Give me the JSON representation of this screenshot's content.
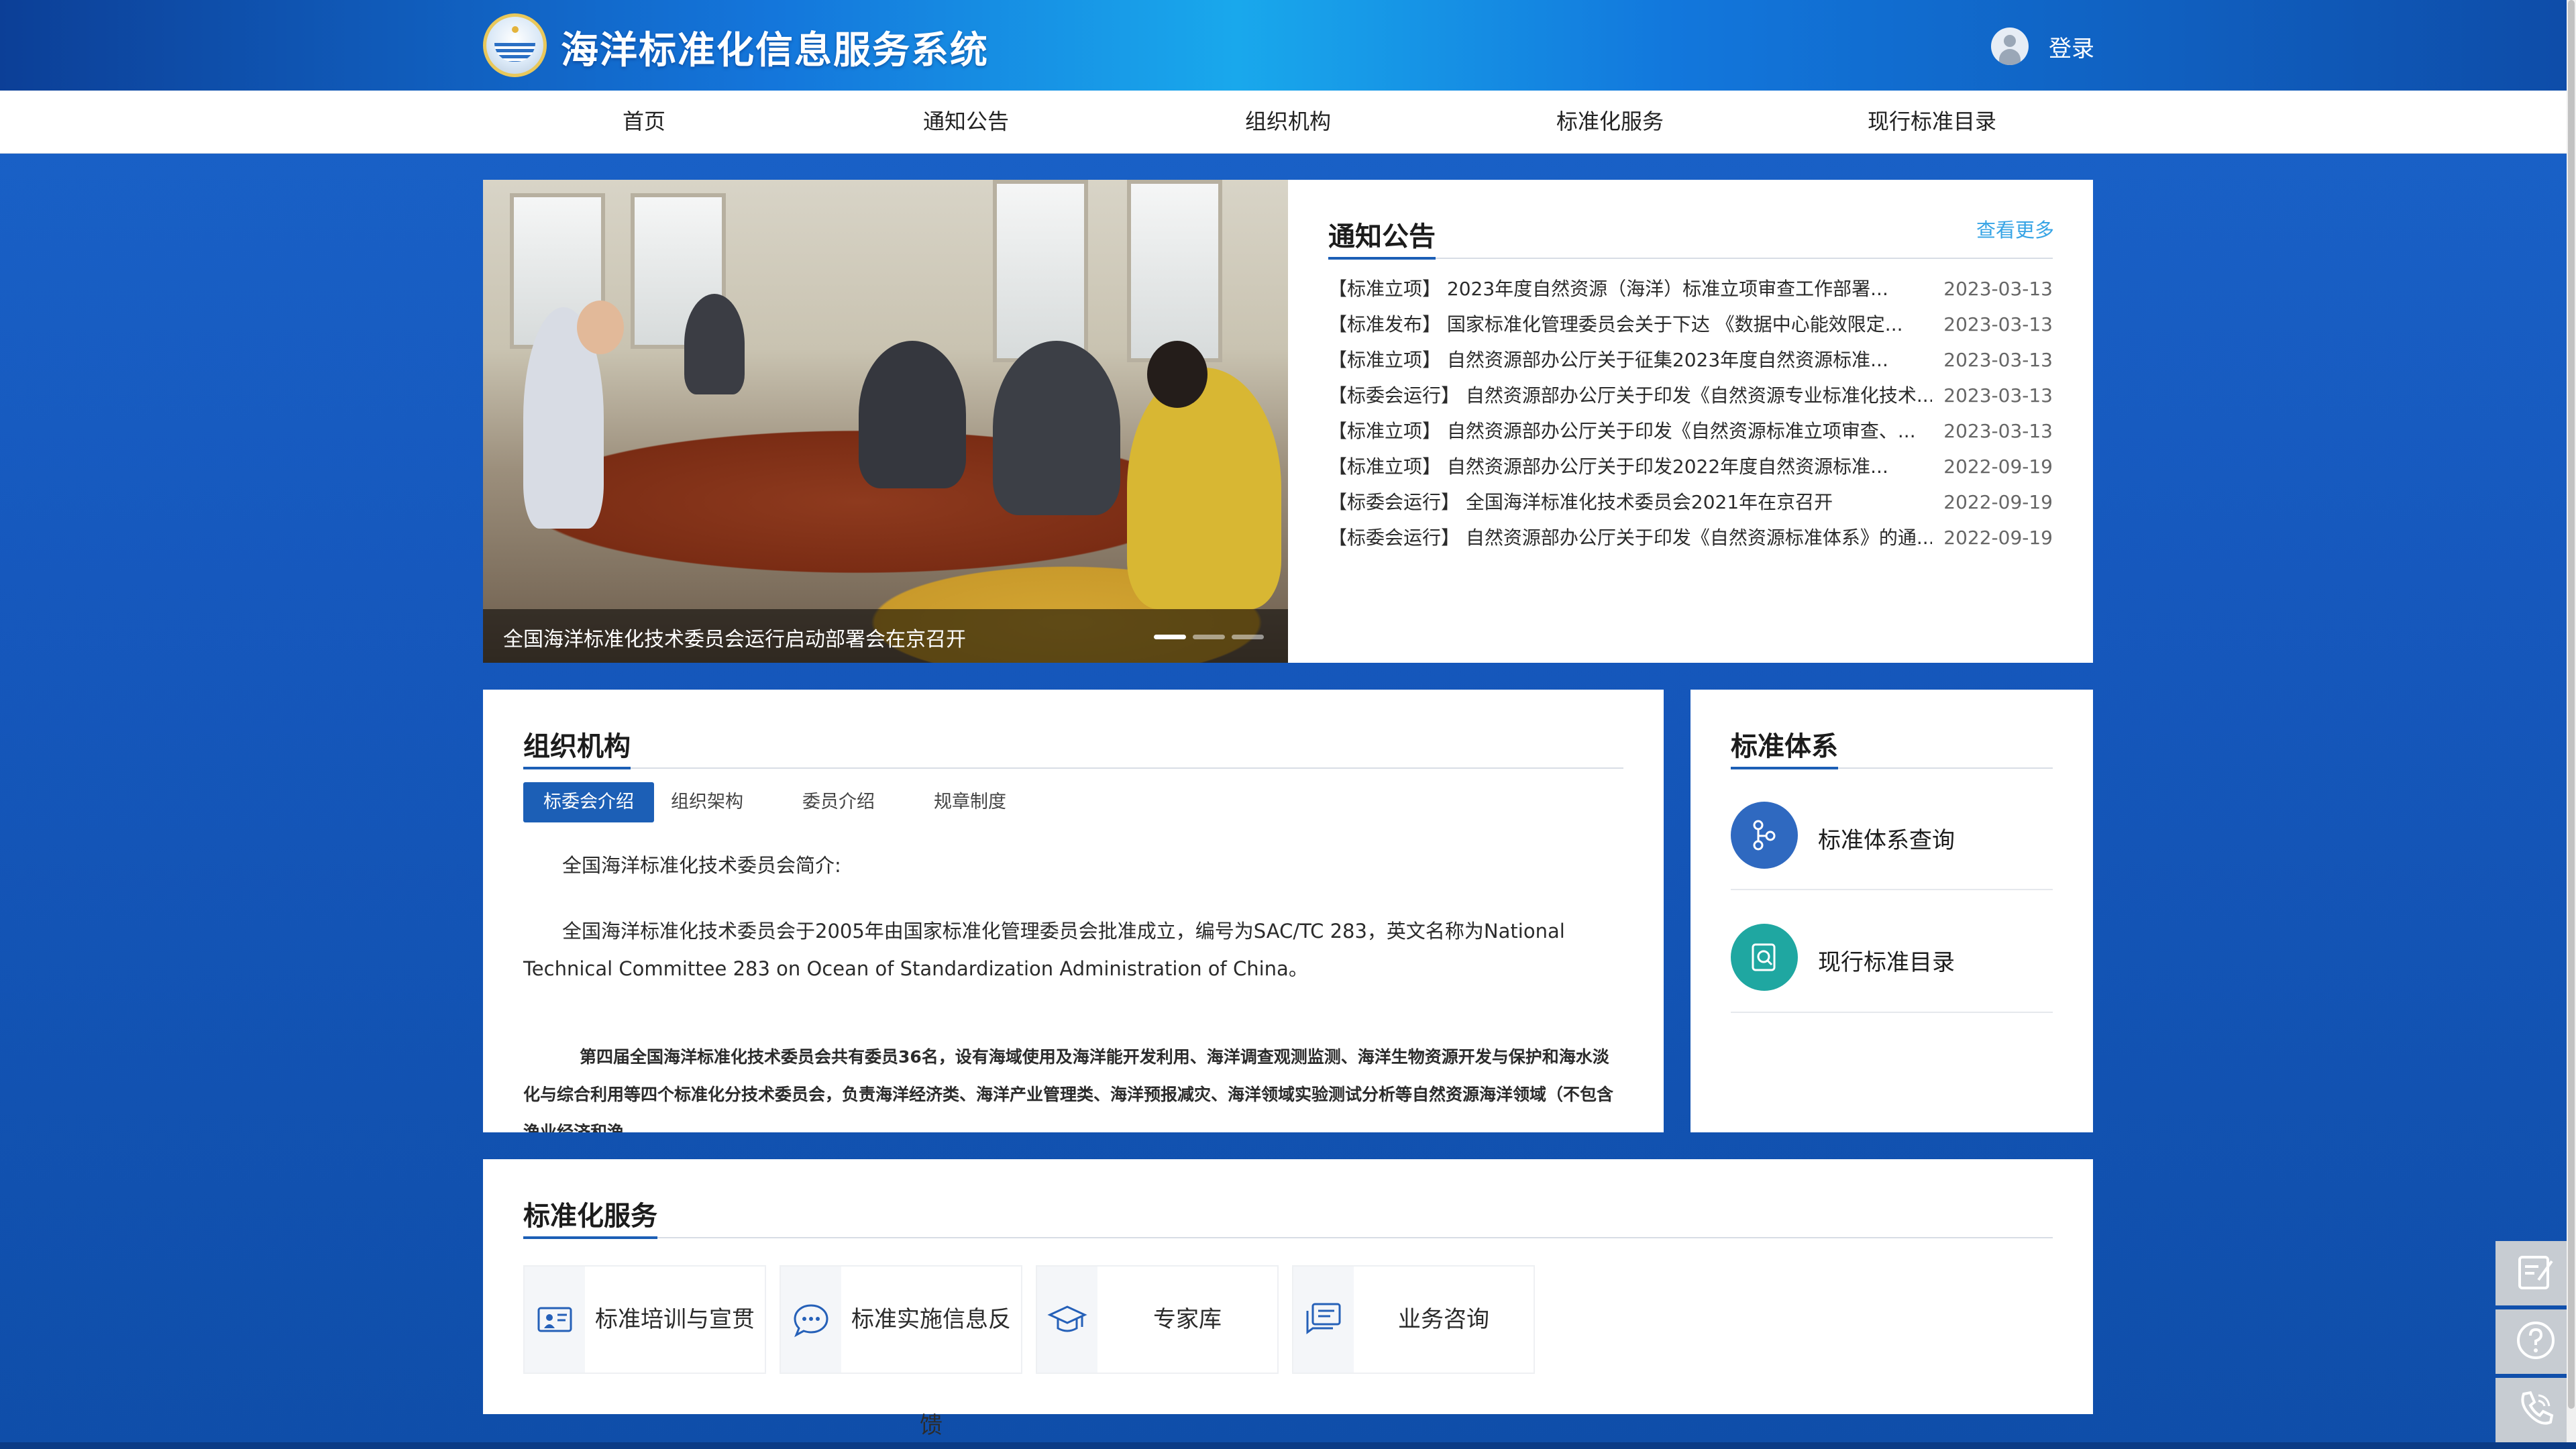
{
  "header": {
    "site_title": "海洋标准化信息服务系统",
    "login_label": "登录"
  },
  "nav": {
    "items": [
      {
        "label": "首页"
      },
      {
        "label": "通知公告"
      },
      {
        "label": "组织机构"
      },
      {
        "label": "标准化服务"
      },
      {
        "label": "现行标准目录"
      }
    ]
  },
  "carousel": {
    "caption": "全国海洋标准化技术委员会运行启动部署会在京召开",
    "slide_count": 3,
    "active_index": 0
  },
  "notices": {
    "title": "通知公告",
    "more_label": "查看更多",
    "items": [
      {
        "text": "【标准立项】 2023年度自然资源（海洋）标准立项审查工作部署...",
        "date": "2023-03-13"
      },
      {
        "text": "【标准发布】 国家标准化管理委员会关于下达 《数据中心能效限定...",
        "date": "2023-03-13"
      },
      {
        "text": "【标准立项】 自然资源部办公厅关于征集2023年度自然资源标准...",
        "date": "2023-03-13"
      },
      {
        "text": "【标委会运行】 自然资源部办公厅关于印发《自然资源专业标准化技术...",
        "date": "2023-03-13"
      },
      {
        "text": "【标准立项】 自然资源部办公厅关于印发《自然资源标准立项审查、...",
        "date": "2023-03-13"
      },
      {
        "text": "【标准立项】 自然资源部办公厅关于印发2022年度自然资源标准...",
        "date": "2022-09-19"
      },
      {
        "text": "【标委会运行】 全国海洋标准化技术委员会2021年在京召开",
        "date": "2022-09-19"
      },
      {
        "text": "【标委会运行】 自然资源部办公厅关于印发《自然资源标准体系》的通...",
        "date": "2022-09-19"
      }
    ]
  },
  "org": {
    "title": "组织机构",
    "tabs": [
      {
        "label": "标委会介绍"
      },
      {
        "label": "组织架构"
      },
      {
        "label": "委员介绍"
      },
      {
        "label": "规章制度"
      }
    ],
    "intro_heading": "全国海洋标准化技术委员会简介:",
    "intro_para1": "全国海洋标准化技术委员会于2005年由国家标准化管理委员会批准成立，编号为SAC/TC 283，英文名称为National Technical Committee 283 on Ocean of Standardization Administration of China。",
    "intro_para2": "第四届全国海洋标准化技术委员会共有委员36名，设有海域使用及海洋能开发利用、海洋调查观测监测、海洋生物资源开发与保护和海水淡化与综合利用等四个标准化分技术委员会，负责海洋经济类、海洋产业管理类、海洋预报减灾、海洋领域实验测试分析等自然资源海洋领域（不包含渔业经济和渔"
  },
  "std_system": {
    "title": "标准体系",
    "items": [
      {
        "label": "标准体系查询",
        "icon": "tree-icon"
      },
      {
        "label": "现行标准目录",
        "icon": "search-doc-icon"
      }
    ]
  },
  "services": {
    "title": "标准化服务",
    "items": [
      {
        "label": "标准培训与宣贯",
        "icon": "training-icon"
      },
      {
        "label": "标准实施信息反馈",
        "icon": "chat-icon"
      },
      {
        "label": "专家库",
        "icon": "graduation-cap-icon"
      },
      {
        "label": "业务咨询",
        "icon": "consult-icon"
      }
    ]
  },
  "colors": {
    "brand": "#1c5fb6",
    "link": "#37a4e5",
    "background": "#1658bd"
  }
}
